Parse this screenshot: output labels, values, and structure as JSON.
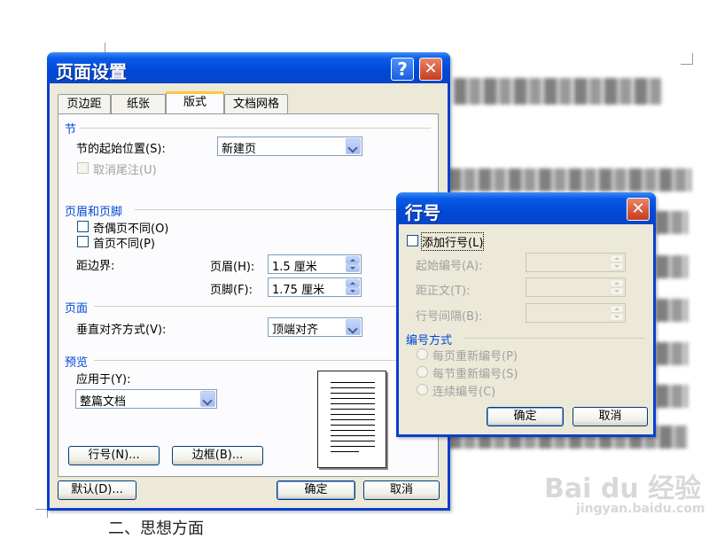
{
  "background_doc": {
    "bottom_text": "二、思想方面",
    "watermark_brand": "Bai du 经验",
    "watermark_url": "jingyan.baidu.com"
  },
  "page_setup": {
    "title": "页面设置",
    "help_button": "?",
    "close_button": "✕",
    "tabs": [
      {
        "label": "页边距"
      },
      {
        "label": "纸张"
      },
      {
        "label": "版式"
      },
      {
        "label": "文档网格"
      }
    ],
    "active_tab": "版式",
    "section": {
      "group_label": "节",
      "start_label": "节的起始位置(S):",
      "start_value": "新建页",
      "suppress_endnotes": "取消尾注(U)"
    },
    "header_footer": {
      "group_label": "页眉和页脚",
      "odd_even": "奇偶页不同(O)",
      "first_page": "首页不同(P)",
      "from_edge": "距边界:",
      "header_label": "页眉(H):",
      "header_value": "1.5 厘米",
      "footer_label": "页脚(F):",
      "footer_value": "1.75 厘米"
    },
    "page": {
      "group_label": "页面",
      "valign_label": "垂直对齐方式(V):",
      "valign_value": "顶端对齐"
    },
    "preview": {
      "group_label": "预览",
      "apply_label": "应用于(Y):",
      "apply_value": "整篇文档"
    },
    "line_numbers_button": "行号(N)...",
    "borders_button": "边框(B)...",
    "default_button": "默认(D)...",
    "ok_button": "确定",
    "cancel_button": "取消"
  },
  "line_numbers": {
    "title": "行号",
    "close_button": "✕",
    "add_line_numbers": "添加行号(L)",
    "start_at": "起始编号(A):",
    "from_text": "距正文(T):",
    "count_by": "行号间隔(B):",
    "numbering_group": "编号方式",
    "restart_each_page": "每页重新编号(P)",
    "restart_each_section": "每节重新编号(S)",
    "continuous": "连续编号(C)",
    "ok_button": "确定",
    "cancel_button": "取消"
  },
  "colors": {
    "xp_title_blue": "#0a5ae8",
    "group_label_blue": "#0046d5",
    "dialog_face": "#ece9d8",
    "close_red": "#c63c1c"
  }
}
